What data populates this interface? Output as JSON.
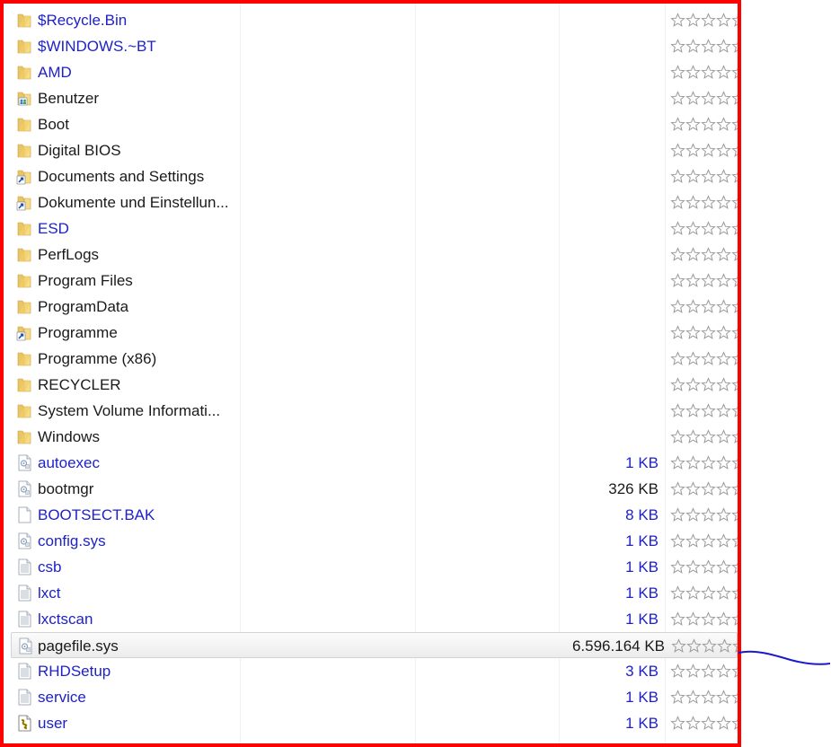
{
  "files": [
    {
      "name": "$Recycle.Bin",
      "size": "",
      "icon": "folder-icon",
      "blue": true
    },
    {
      "name": "$WINDOWS.~BT",
      "size": "",
      "icon": "folder-icon",
      "blue": true
    },
    {
      "name": "AMD",
      "size": "",
      "icon": "folder-icon",
      "blue": true
    },
    {
      "name": "Benutzer",
      "size": "",
      "icon": "folder-users-icon",
      "blue": false
    },
    {
      "name": "Boot",
      "size": "",
      "icon": "folder-icon",
      "blue": false
    },
    {
      "name": "Digital BIOS",
      "size": "",
      "icon": "folder-icon",
      "blue": false
    },
    {
      "name": "Documents and Settings",
      "size": "",
      "icon": "shortcut-icon",
      "blue": false
    },
    {
      "name": "Dokumente und Einstellun...",
      "size": "",
      "icon": "shortcut-icon",
      "blue": false
    },
    {
      "name": "ESD",
      "size": "",
      "icon": "folder-icon",
      "blue": true
    },
    {
      "name": "PerfLogs",
      "size": "",
      "icon": "folder-icon",
      "blue": false
    },
    {
      "name": "Program Files",
      "size": "",
      "icon": "folder-icon",
      "blue": false
    },
    {
      "name": "ProgramData",
      "size": "",
      "icon": "folder-icon",
      "blue": false
    },
    {
      "name": "Programme",
      "size": "",
      "icon": "shortcut-icon",
      "blue": false
    },
    {
      "name": "Programme (x86)",
      "size": "",
      "icon": "folder-icon",
      "blue": false
    },
    {
      "name": "RECYCLER",
      "size": "",
      "icon": "folder-icon",
      "blue": false
    },
    {
      "name": "System Volume Informati...",
      "size": "",
      "icon": "folder-icon",
      "blue": false
    },
    {
      "name": "Windows",
      "size": "",
      "icon": "folder-icon",
      "blue": false
    },
    {
      "name": "autoexec",
      "size": "1 KB",
      "icon": "system-file-icon",
      "blue": true
    },
    {
      "name": "bootmgr",
      "size": "326 KB",
      "icon": "system-file-icon",
      "blue": false
    },
    {
      "name": "BOOTSECT.BAK",
      "size": "8 KB",
      "icon": "blank-file-icon",
      "blue": true
    },
    {
      "name": "config.sys",
      "size": "1 KB",
      "icon": "system-file-icon",
      "blue": true
    },
    {
      "name": "csb",
      "size": "1 KB",
      "icon": "text-file-icon",
      "blue": true
    },
    {
      "name": "lxct",
      "size": "1 KB",
      "icon": "text-file-icon",
      "blue": true
    },
    {
      "name": "lxctscan",
      "size": "1 KB",
      "icon": "text-file-icon",
      "blue": true
    },
    {
      "name": "pagefile.sys",
      "size": "6.596.164 KB",
      "icon": "system-file-icon",
      "blue": false,
      "selected": true
    },
    {
      "name": "RHDSetup",
      "size": "3 KB",
      "icon": "text-file-icon",
      "blue": true
    },
    {
      "name": "service",
      "size": "1 KB",
      "icon": "text-file-icon",
      "blue": true
    },
    {
      "name": "user",
      "size": "1 KB",
      "icon": "script-file-icon",
      "blue": true
    }
  ],
  "rating": {
    "stars_total": 5,
    "stars_filled": 0
  }
}
